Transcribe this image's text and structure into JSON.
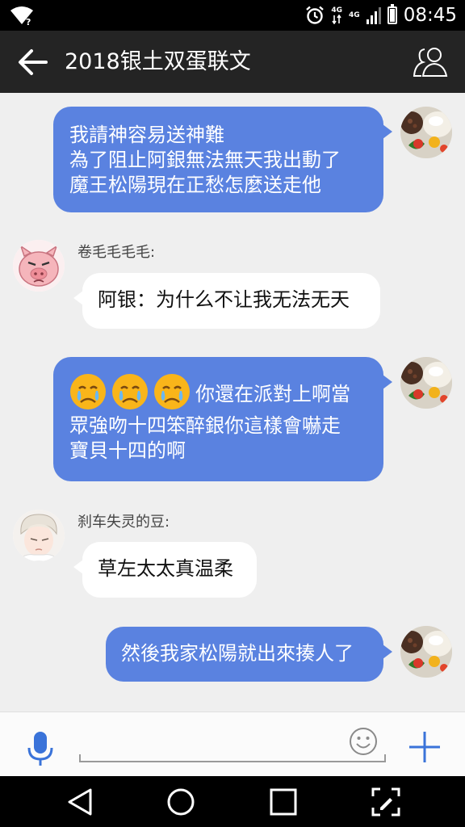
{
  "status": {
    "time": "08:45",
    "net_top": "4G",
    "net_bottom": "4G"
  },
  "header": {
    "title": "2018银土双蛋联文"
  },
  "messages": [
    {
      "direction": "out",
      "lines": [
        "我請神容易送神難",
        "為了阻止阿銀無法無天我出動了",
        "魔王松陽現在正愁怎麼送走他"
      ]
    },
    {
      "direction": "in",
      "sender": "卷毛毛毛毛:",
      "lines": [
        "阿银：为什么不让我无法无天"
      ]
    },
    {
      "direction": "out",
      "lines": [
        "你還在派對上啊當",
        "眾強吻十四笨醉銀你這樣會嚇走",
        "寶貝十四的啊"
      ],
      "emoji_count": 3
    },
    {
      "direction": "in",
      "sender": "刹车失灵的豆:",
      "lines": [
        "草左太太真温柔"
      ]
    },
    {
      "direction": "out",
      "lines": [
        "然後我家松陽就出來揍人了"
      ]
    }
  ],
  "input": {
    "value": "",
    "placeholder": ""
  },
  "icons": {
    "back": "arrow-left-icon",
    "group": "people-icon",
    "mic": "microphone-icon",
    "emoji": "smiley-icon",
    "add": "plus-icon"
  },
  "colors": {
    "header": "#242424",
    "outgoing_bubble": "#5a82e0",
    "incoming_bubble": "#ffffff",
    "accent": "#3a73d9",
    "background": "#efefef"
  }
}
